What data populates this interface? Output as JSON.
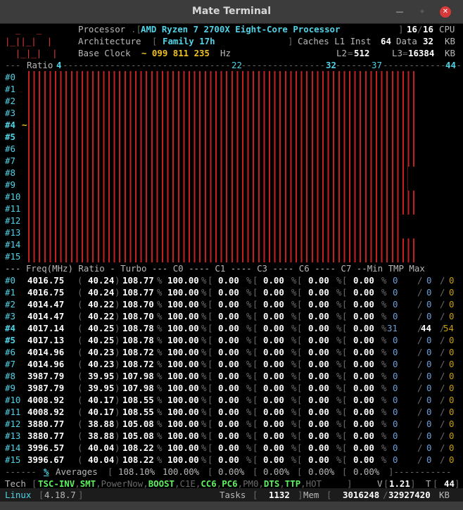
{
  "window": {
    "title": "Mate Terminal",
    "min_icon": "minimize-icon",
    "max_icon": "maximize-icon",
    "close_icon": "close-icon"
  },
  "header": {
    "processor_label": "Processor",
    "processor_name": "AMD Ryzen 7 2700X Eight-Core Processor",
    "threads_active": "16",
    "threads_total": "16",
    "cpu_label": "CPU",
    "arch_label": "Architecture",
    "arch_value": "Family 17h",
    "caches_label": "Caches L1 Inst",
    "l1_inst": "64",
    "l1_data_label": "Data",
    "l1_data": "32",
    "kb_label": "KB",
    "baseclock_label": "Base Clock",
    "baseclock_value": "~ 099 811 235",
    "hz_label": "Hz",
    "l2_label": "L2",
    "l2": "512",
    "l3_label": "L3",
    "l3": "16384",
    "kb2_label": "KB"
  },
  "ratio_ruler": {
    "label": "Ratio",
    "marks": [
      "4",
      "22",
      "32",
      "37",
      "44"
    ]
  },
  "bar_rows": [
    {
      "id": "#0",
      "fill": 0.913
    },
    {
      "id": "#1",
      "fill": 0.913
    },
    {
      "id": "#2",
      "fill": 0.913
    },
    {
      "id": "#3",
      "fill": 0.913
    },
    {
      "id": "#4",
      "fill": 0.913,
      "marker": "~"
    },
    {
      "id": "#5",
      "fill": 0.913
    },
    {
      "id": "#6",
      "fill": 0.913
    },
    {
      "id": "#7",
      "fill": 0.913
    },
    {
      "id": "#8",
      "fill": 0.898
    },
    {
      "id": "#9",
      "fill": 0.898
    },
    {
      "id": "#10",
      "fill": 0.913
    },
    {
      "id": "#11",
      "fill": 0.913
    },
    {
      "id": "#12",
      "fill": 0.885
    },
    {
      "id": "#13",
      "fill": 0.885
    },
    {
      "id": "#14",
      "fill": 0.913
    },
    {
      "id": "#15",
      "fill": 0.913
    }
  ],
  "table_header": "--- Freq(MHz) Ratio - Turbo --- C0 ---- C1 ---- C3 ---- C6 ---- C7 --Min TMP Max",
  "cpu_rows": [
    {
      "id": "#0",
      "freq": "4016.75",
      "ratio": "40.24",
      "turbo": "108.77",
      "c0": "100.00",
      "c1": "0.00",
      "c3": "0.00",
      "c6": "0.00",
      "c7": "0.00",
      "min": "0",
      "tmp": "0",
      "max": "0"
    },
    {
      "id": "#1",
      "freq": "4016.75",
      "ratio": "40.24",
      "turbo": "108.77",
      "c0": "100.00",
      "c1": "0.00",
      "c3": "0.00",
      "c6": "0.00",
      "c7": "0.00",
      "min": "0",
      "tmp": "0",
      "max": "0"
    },
    {
      "id": "#2",
      "freq": "4014.47",
      "ratio": "40.22",
      "turbo": "108.70",
      "c0": "100.00",
      "c1": "0.00",
      "c3": "0.00",
      "c6": "0.00",
      "c7": "0.00",
      "min": "0",
      "tmp": "0",
      "max": "0"
    },
    {
      "id": "#3",
      "freq": "4014.47",
      "ratio": "40.22",
      "turbo": "108.70",
      "c0": "100.00",
      "c1": "0.00",
      "c3": "0.00",
      "c6": "0.00",
      "c7": "0.00",
      "min": "0",
      "tmp": "0",
      "max": "0"
    },
    {
      "id": "#4",
      "freq": "4017.14",
      "ratio": "40.25",
      "turbo": "108.78",
      "c0": "100.00",
      "c1": "0.00",
      "c3": "0.00",
      "c6": "0.00",
      "c7": "0.00",
      "min": "31",
      "tmp": "44",
      "max": "54"
    },
    {
      "id": "#5",
      "freq": "4017.13",
      "ratio": "40.25",
      "turbo": "108.78",
      "c0": "100.00",
      "c1": "0.00",
      "c3": "0.00",
      "c6": "0.00",
      "c7": "0.00",
      "min": "0",
      "tmp": "0",
      "max": "0"
    },
    {
      "id": "#6",
      "freq": "4014.96",
      "ratio": "40.23",
      "turbo": "108.72",
      "c0": "100.00",
      "c1": "0.00",
      "c3": "0.00",
      "c6": "0.00",
      "c7": "0.00",
      "min": "0",
      "tmp": "0",
      "max": "0"
    },
    {
      "id": "#7",
      "freq": "4014.96",
      "ratio": "40.23",
      "turbo": "108.72",
      "c0": "100.00",
      "c1": "0.00",
      "c3": "0.00",
      "c6": "0.00",
      "c7": "0.00",
      "min": "0",
      "tmp": "0",
      "max": "0"
    },
    {
      "id": "#8",
      "freq": "3987.79",
      "ratio": "39.95",
      "turbo": "107.98",
      "c0": "100.00",
      "c1": "0.00",
      "c3": "0.00",
      "c6": "0.00",
      "c7": "0.00",
      "min": "0",
      "tmp": "0",
      "max": "0"
    },
    {
      "id": "#9",
      "freq": "3987.79",
      "ratio": "39.95",
      "turbo": "107.98",
      "c0": "100.00",
      "c1": "0.00",
      "c3": "0.00",
      "c6": "0.00",
      "c7": "0.00",
      "min": "0",
      "tmp": "0",
      "max": "0"
    },
    {
      "id": "#10",
      "freq": "4008.92",
      "ratio": "40.17",
      "turbo": "108.55",
      "c0": "100.00",
      "c1": "0.00",
      "c3": "0.00",
      "c6": "0.00",
      "c7": "0.00",
      "min": "0",
      "tmp": "0",
      "max": "0"
    },
    {
      "id": "#11",
      "freq": "4008.92",
      "ratio": "40.17",
      "turbo": "108.55",
      "c0": "100.00",
      "c1": "0.00",
      "c3": "0.00",
      "c6": "0.00",
      "c7": "0.00",
      "min": "0",
      "tmp": "0",
      "max": "0"
    },
    {
      "id": "#12",
      "freq": "3880.77",
      "ratio": "38.88",
      "turbo": "105.08",
      "c0": "100.00",
      "c1": "0.00",
      "c3": "0.00",
      "c6": "0.00",
      "c7": "0.00",
      "min": "0",
      "tmp": "0",
      "max": "0"
    },
    {
      "id": "#13",
      "freq": "3880.77",
      "ratio": "38.88",
      "turbo": "105.08",
      "c0": "100.00",
      "c1": "0.00",
      "c3": "0.00",
      "c6": "0.00",
      "c7": "0.00",
      "min": "0",
      "tmp": "0",
      "max": "0"
    },
    {
      "id": "#14",
      "freq": "3996.57",
      "ratio": "40.04",
      "turbo": "108.22",
      "c0": "100.00",
      "c1": "0.00",
      "c3": "0.00",
      "c6": "0.00",
      "c7": "0.00",
      "min": "0",
      "tmp": "0",
      "max": "0"
    },
    {
      "id": "#15",
      "freq": "3996.67",
      "ratio": "40.04",
      "turbo": "108.22",
      "c0": "100.00",
      "c1": "0.00",
      "c3": "0.00",
      "c6": "0.00",
      "c7": "0.00",
      "min": "0",
      "tmp": "0",
      "max": "0"
    }
  ],
  "averages": {
    "pct": "%",
    "label": "Averages",
    "turbo": "108.10%",
    "c0": "100.00%",
    "c1": "0.00%",
    "c3": "0.00%",
    "c6": "0.00%",
    "c7": "0.00%"
  },
  "tech": {
    "label": "Tech",
    "items": [
      {
        "name": "TSC-INV",
        "on": true
      },
      {
        "name": "SMT",
        "on": true
      },
      {
        "name": "PowerNow",
        "on": false
      },
      {
        "name": "BOOST",
        "on": true
      },
      {
        "name": "C1E",
        "on": false
      },
      {
        "name": "CC6",
        "on": true
      },
      {
        "name": "PC6",
        "on": true
      },
      {
        "name": "PM0",
        "on": false
      },
      {
        "name": "DTS",
        "on": true
      },
      {
        "name": "TTP",
        "on": true
      },
      {
        "name": "HOT",
        "on": false
      }
    ],
    "v_label": "V",
    "v_value": "1.21",
    "t_label": "T",
    "t_value": "44"
  },
  "status": {
    "os_label": "Linux",
    "kernel": "4.18.7",
    "tasks_label": "Tasks",
    "tasks": "1132",
    "mem_label": "Mem",
    "mem_used": "3016248",
    "mem_total": "32927420",
    "mem_unit": "KB"
  },
  "colors": {
    "bar": "#c42020",
    "cyan": "#4fd3e6",
    "yellow": "#f0c020",
    "green": "#5ff05f",
    "red": "#e83838"
  }
}
